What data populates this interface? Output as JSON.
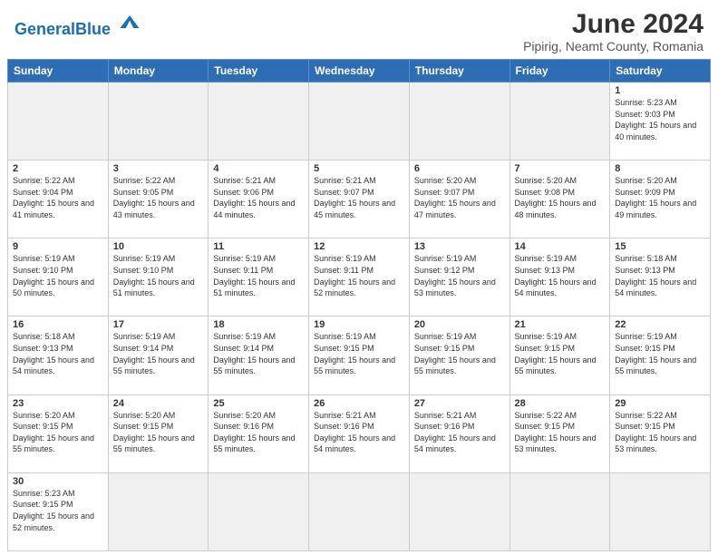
{
  "header": {
    "logo_general": "General",
    "logo_blue": "Blue",
    "title": "June 2024",
    "subtitle": "Pipirig, Neamt County, Romania"
  },
  "days_of_week": [
    "Sunday",
    "Monday",
    "Tuesday",
    "Wednesday",
    "Thursday",
    "Friday",
    "Saturday"
  ],
  "weeks": [
    [
      {
        "day": "",
        "empty": true
      },
      {
        "day": "",
        "empty": true
      },
      {
        "day": "",
        "empty": true
      },
      {
        "day": "",
        "empty": true
      },
      {
        "day": "",
        "empty": true
      },
      {
        "day": "",
        "empty": true
      },
      {
        "day": "1",
        "sunrise": "5:23 AM",
        "sunset": "9:03 PM",
        "daylight": "15 hours and 40 minutes."
      }
    ],
    [
      {
        "day": "2",
        "sunrise": "5:22 AM",
        "sunset": "9:04 PM",
        "daylight": "15 hours and 41 minutes."
      },
      {
        "day": "3",
        "sunrise": "5:22 AM",
        "sunset": "9:05 PM",
        "daylight": "15 hours and 43 minutes."
      },
      {
        "day": "4",
        "sunrise": "5:21 AM",
        "sunset": "9:06 PM",
        "daylight": "15 hours and 44 minutes."
      },
      {
        "day": "5",
        "sunrise": "5:21 AM",
        "sunset": "9:07 PM",
        "daylight": "15 hours and 45 minutes."
      },
      {
        "day": "6",
        "sunrise": "5:20 AM",
        "sunset": "9:07 PM",
        "daylight": "15 hours and 47 minutes."
      },
      {
        "day": "7",
        "sunrise": "5:20 AM",
        "sunset": "9:08 PM",
        "daylight": "15 hours and 48 minutes."
      },
      {
        "day": "8",
        "sunrise": "5:20 AM",
        "sunset": "9:09 PM",
        "daylight": "15 hours and 49 minutes."
      }
    ],
    [
      {
        "day": "9",
        "sunrise": "5:19 AM",
        "sunset": "9:10 PM",
        "daylight": "15 hours and 50 minutes."
      },
      {
        "day": "10",
        "sunrise": "5:19 AM",
        "sunset": "9:10 PM",
        "daylight": "15 hours and 51 minutes."
      },
      {
        "day": "11",
        "sunrise": "5:19 AM",
        "sunset": "9:11 PM",
        "daylight": "15 hours and 51 minutes."
      },
      {
        "day": "12",
        "sunrise": "5:19 AM",
        "sunset": "9:11 PM",
        "daylight": "15 hours and 52 minutes."
      },
      {
        "day": "13",
        "sunrise": "5:19 AM",
        "sunset": "9:12 PM",
        "daylight": "15 hours and 53 minutes."
      },
      {
        "day": "14",
        "sunrise": "5:19 AM",
        "sunset": "9:13 PM",
        "daylight": "15 hours and 54 minutes."
      },
      {
        "day": "15",
        "sunrise": "5:18 AM",
        "sunset": "9:13 PM",
        "daylight": "15 hours and 54 minutes."
      }
    ],
    [
      {
        "day": "16",
        "sunrise": "5:18 AM",
        "sunset": "9:13 PM",
        "daylight": "15 hours and 54 minutes."
      },
      {
        "day": "17",
        "sunrise": "5:19 AM",
        "sunset": "9:14 PM",
        "daylight": "15 hours and 55 minutes."
      },
      {
        "day": "18",
        "sunrise": "5:19 AM",
        "sunset": "9:14 PM",
        "daylight": "15 hours and 55 minutes."
      },
      {
        "day": "19",
        "sunrise": "5:19 AM",
        "sunset": "9:15 PM",
        "daylight": "15 hours and 55 minutes."
      },
      {
        "day": "20",
        "sunrise": "5:19 AM",
        "sunset": "9:15 PM",
        "daylight": "15 hours and 55 minutes."
      },
      {
        "day": "21",
        "sunrise": "5:19 AM",
        "sunset": "9:15 PM",
        "daylight": "15 hours and 55 minutes."
      },
      {
        "day": "22",
        "sunrise": "5:19 AM",
        "sunset": "9:15 PM",
        "daylight": "15 hours and 55 minutes."
      }
    ],
    [
      {
        "day": "23",
        "sunrise": "5:20 AM",
        "sunset": "9:15 PM",
        "daylight": "15 hours and 55 minutes."
      },
      {
        "day": "24",
        "sunrise": "5:20 AM",
        "sunset": "9:15 PM",
        "daylight": "15 hours and 55 minutes."
      },
      {
        "day": "25",
        "sunrise": "5:20 AM",
        "sunset": "9:16 PM",
        "daylight": "15 hours and 55 minutes."
      },
      {
        "day": "26",
        "sunrise": "5:21 AM",
        "sunset": "9:16 PM",
        "daylight": "15 hours and 54 minutes."
      },
      {
        "day": "27",
        "sunrise": "5:21 AM",
        "sunset": "9:16 PM",
        "daylight": "15 hours and 54 minutes."
      },
      {
        "day": "28",
        "sunrise": "5:22 AM",
        "sunset": "9:15 PM",
        "daylight": "15 hours and 53 minutes."
      },
      {
        "day": "29",
        "sunrise": "5:22 AM",
        "sunset": "9:15 PM",
        "daylight": "15 hours and 53 minutes."
      }
    ],
    [
      {
        "day": "30",
        "sunrise": "5:23 AM",
        "sunset": "9:15 PM",
        "daylight": "15 hours and 52 minutes.",
        "last": true
      },
      {
        "day": "",
        "empty": true,
        "last": true
      },
      {
        "day": "",
        "empty": true,
        "last": true
      },
      {
        "day": "",
        "empty": true,
        "last": true
      },
      {
        "day": "",
        "empty": true,
        "last": true
      },
      {
        "day": "",
        "empty": true,
        "last": true
      },
      {
        "day": "",
        "empty": true,
        "last": true
      }
    ]
  ]
}
